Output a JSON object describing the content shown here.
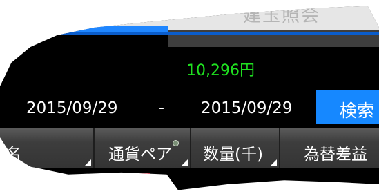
{
  "header": {
    "title": "建玉照会"
  },
  "summary": {
    "amount": "10,296円"
  },
  "date_range": {
    "from": "2015/09/29",
    "separator": "-",
    "to": "2015/09/29"
  },
  "search_button": {
    "label": "検索"
  },
  "table": {
    "columns": [
      {
        "label": "銘柄名"
      },
      {
        "label": "通貨ペア"
      },
      {
        "label": "数量(千)"
      },
      {
        "label": "為替差益"
      }
    ]
  },
  "colors": {
    "accent": "#1f86ff",
    "amount_green": "#1fe020",
    "button_blue": "#1688ff"
  },
  "icons": {
    "row_flag": "us-flag-icon",
    "sort": "sort-triangle-icon"
  }
}
